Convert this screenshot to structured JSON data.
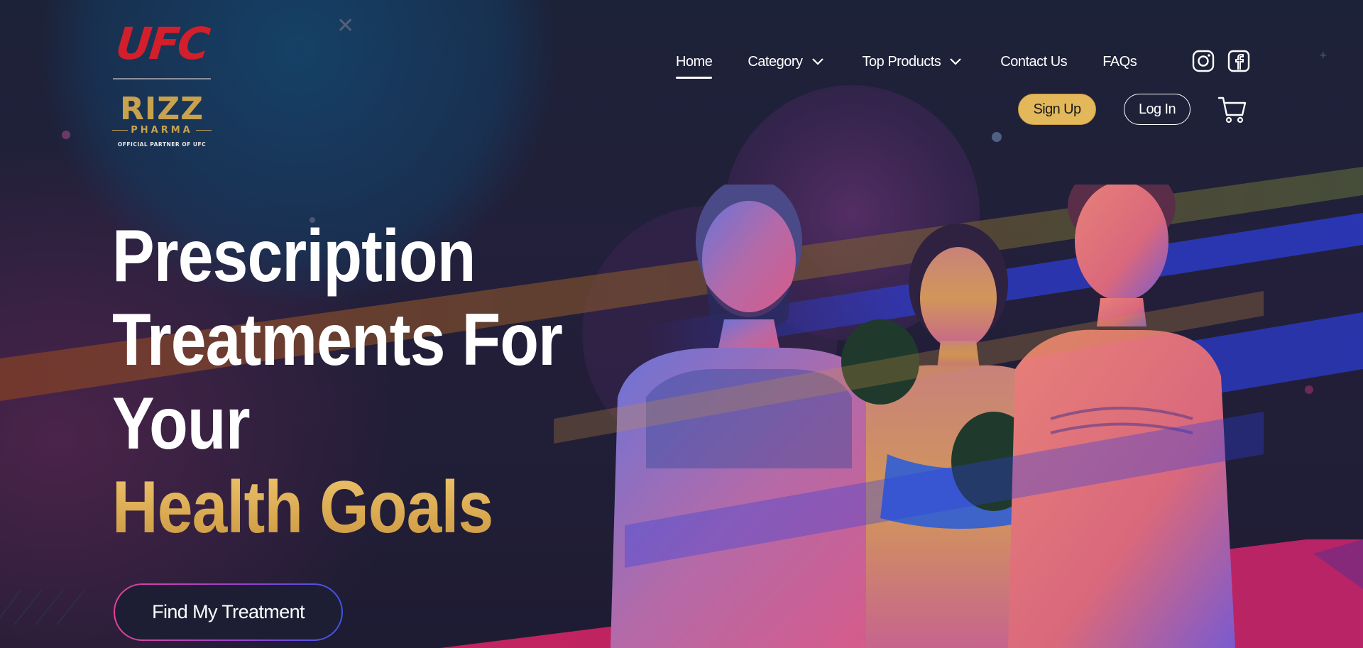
{
  "brand": {
    "ufc": "UFC",
    "rizz": "RIZZ",
    "pharma": "PHARMA",
    "partner": "OFFICIAL PARTNER OF UFC"
  },
  "nav": {
    "items": [
      {
        "label": "Home",
        "active": true
      },
      {
        "label": "Category",
        "dropdown": true
      },
      {
        "label": "Top Products",
        "dropdown": true
      },
      {
        "label": "Contact Us"
      },
      {
        "label": "FAQs"
      }
    ],
    "social": [
      "instagram-icon",
      "facebook-icon"
    ]
  },
  "auth": {
    "signup": "Sign Up",
    "login": "Log In"
  },
  "hero": {
    "line1": "Prescription",
    "line2": "Treatments For",
    "line3": "Your",
    "line4_gold": "Health Goals",
    "cta": "Find My Treatment"
  },
  "colors": {
    "accent_gold": "#e2b85b",
    "ufc_red": "#d21f2b",
    "magenta": "#c2245f"
  }
}
